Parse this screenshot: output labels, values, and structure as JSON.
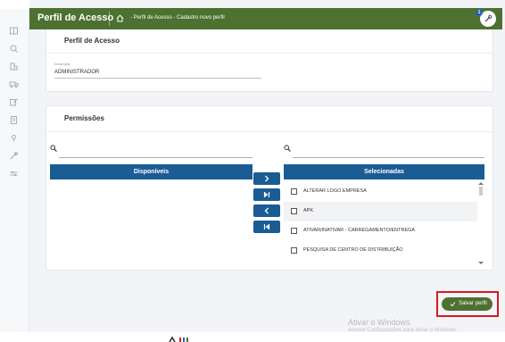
{
  "header": {
    "app_title": "Perfil de Acesso",
    "breadcrumb": "- Perfil de Acesso - Cadastro novo perfil",
    "notification_count": "1"
  },
  "profile_card": {
    "title": "Perfil de Acesso",
    "description_label": "Descrição",
    "description_value": "ADMINISTRADOR"
  },
  "permissions_card": {
    "title": "Permissões",
    "available_header": "Disponíveis",
    "selected_header": "Selecionadas",
    "selected_items": [
      "ALTERAR LOGO EMPRESA",
      "APK",
      "ATIVAR/INATIVAR - CARREGAMENTO/ENTREGA",
      "PESQUISA DE CENTRO DE DISTRIBUIÇÃO"
    ]
  },
  "actions": {
    "save_label": "Salvar perfil"
  },
  "watermark": {
    "title": "Ativar o Windows",
    "subtitle": "Acesse Configurações para ativar o Windows."
  },
  "colors": {
    "header_green": "#4d7130",
    "list_blue": "#1b5c94",
    "highlight_red": "#d21d24"
  }
}
